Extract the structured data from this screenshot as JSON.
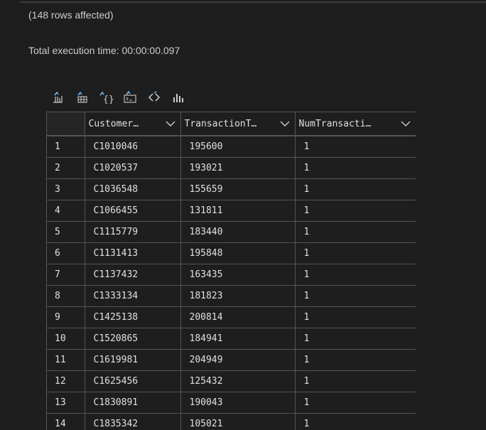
{
  "messages": {
    "rows_affected": "(148 rows affected)",
    "execution_time": "Total execution time: 00:00:00.097"
  },
  "toolbar": {
    "buttons": [
      {
        "name": "save-as-csv-icon",
        "tooltip": "Save as CSV"
      },
      {
        "name": "save-as-excel-icon",
        "tooltip": "Save as Excel"
      },
      {
        "name": "save-as-json-icon",
        "tooltip": "Save as JSON"
      },
      {
        "name": "save-as-xml-icon",
        "tooltip": "Save as XML"
      },
      {
        "name": "copy-code-icon",
        "tooltip": "Copy"
      },
      {
        "name": "chart-icon",
        "tooltip": "Chart"
      }
    ]
  },
  "table": {
    "columns": [
      "Customer…",
      "TransactionT…",
      "NumTransacti…"
    ],
    "rows": [
      [
        "1",
        "C1010046",
        "195600",
        "1"
      ],
      [
        "2",
        "C1020537",
        "193021",
        "1"
      ],
      [
        "3",
        "C1036548",
        "155659",
        "1"
      ],
      [
        "4",
        "C1066455",
        "131811",
        "1"
      ],
      [
        "5",
        "C1115779",
        "183440",
        "1"
      ],
      [
        "6",
        "C1131413",
        "195848",
        "1"
      ],
      [
        "7",
        "C1137432",
        "163435",
        "1"
      ],
      [
        "8",
        "C1333134",
        "181823",
        "1"
      ],
      [
        "9",
        "C1425138",
        "200814",
        "1"
      ],
      [
        "10",
        "C1520865",
        "184941",
        "1"
      ],
      [
        "11",
        "C1619981",
        "204949",
        "1"
      ],
      [
        "12",
        "C1625456",
        "125432",
        "1"
      ],
      [
        "13",
        "C1830891",
        "190043",
        "1"
      ],
      [
        "14",
        "C1835342",
        "105021",
        "1"
      ]
    ]
  },
  "colors": {
    "background": "#1e1e1e",
    "grid_line": "#555555",
    "icon_blue": "#75beff",
    "text": "#cccccc"
  }
}
